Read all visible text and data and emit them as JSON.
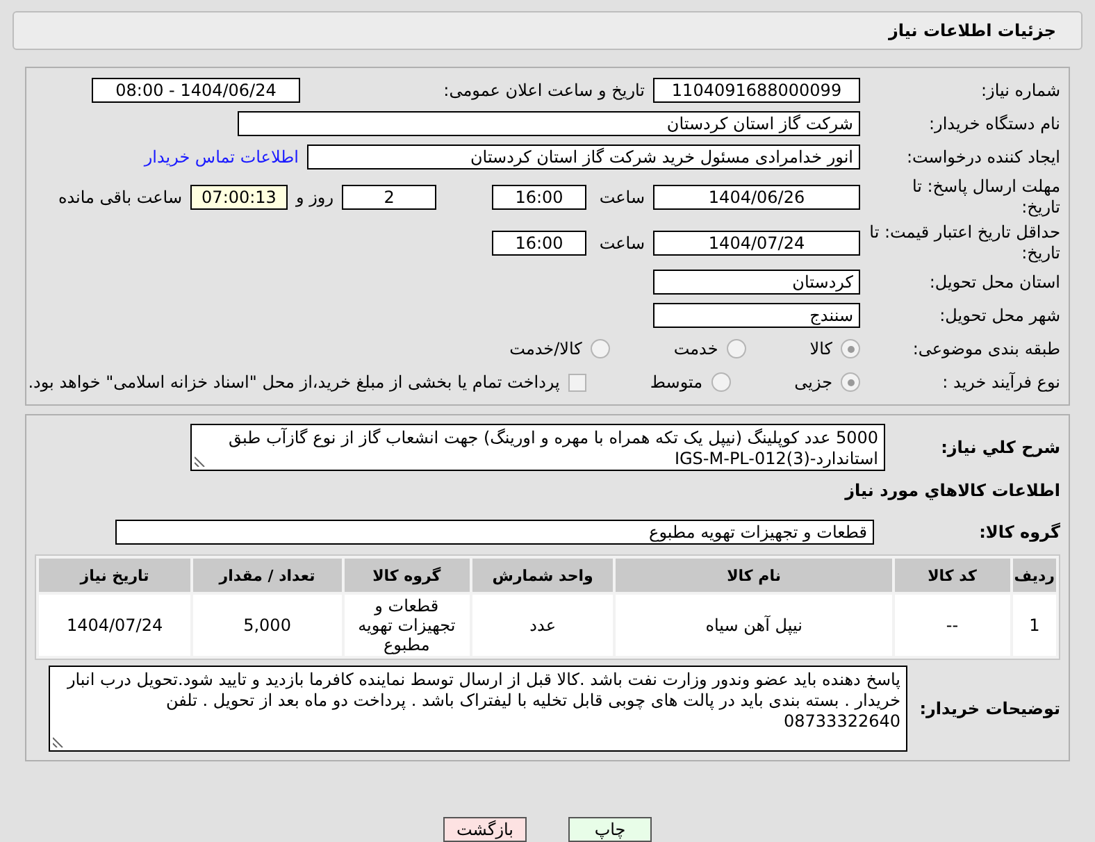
{
  "header": {
    "title": "جزئیات اطلاعات نیاز"
  },
  "need_number": {
    "label": "شماره نیاز:",
    "value": "1104091688000099"
  },
  "announce": {
    "label": "تاریخ و ساعت اعلان عمومی:",
    "value": "1404/06/24 - 08:00"
  },
  "buyer_org": {
    "label": "نام دستگاه خریدار:",
    "value": "شرکت گاز استان کردستان"
  },
  "creator": {
    "label": "ایجاد کننده درخواست:",
    "value": "انور خدامرادی مسئول خرید  شرکت گاز استان کردستان",
    "link": "اطلاعات تماس خریدار"
  },
  "response_deadline": {
    "label": "مهلت ارسال پاسخ: تا تاریخ:",
    "date": "1404/06/26",
    "time_label": "ساعت",
    "time": "16:00",
    "days": "2",
    "days_label": "روز و",
    "remaining": "07:00:13",
    "remaining_label": "ساعت باقی مانده"
  },
  "price_validity": {
    "label": "حداقل تاریخ اعتبار قیمت: تا تاریخ:",
    "date": "1404/07/24",
    "time_label": "ساعت",
    "time": "16:00"
  },
  "province": {
    "label": "استان محل تحویل:",
    "value": "کردستان"
  },
  "city": {
    "label": "شهر محل تحویل:",
    "value": "سنندج"
  },
  "category": {
    "label": "طبقه بندی موضوعی:",
    "options": [
      {
        "label": "کالا",
        "selected": true
      },
      {
        "label": "خدمت",
        "selected": false
      },
      {
        "label": "کالا/خدمت",
        "selected": false
      }
    ]
  },
  "process": {
    "label": "نوع فرآیند خرید :",
    "options": [
      {
        "label": "جزیی",
        "selected": true
      },
      {
        "label": "متوسط",
        "selected": false
      }
    ],
    "treasury": {
      "label": "پرداخت تمام یا بخشی از مبلغ خرید،از محل \"اسناد خزانه اسلامی\" خواهد بود.",
      "checked": false
    }
  },
  "summary": {
    "label": "شرح کلي نياز:",
    "value": "5000 عدد کوپلینگ (نیپل یک تکه همراه با مهره و اورینگ) جهت انشعاب گاز از نوع گازآب طبق استاندارد-IGS-M-PL-012(3)"
  },
  "goods_heading": "اطلاعات کالاهاي مورد نياز",
  "goods_group": {
    "label": "گروه کالا:",
    "value": "قطعات و تجهیزات تهویه مطبوع"
  },
  "table": {
    "columns": [
      "ردیف",
      "کد کالا",
      "نام کالا",
      "واحد شمارش",
      "گروه کالا",
      "تعداد / مقدار",
      "تاریخ نیاز"
    ],
    "rows": [
      [
        "1",
        "--",
        "نیپل آهن سیاه",
        "عدد",
        "قطعات و تجهیزات تهویه مطبوع",
        "5,000",
        "1404/07/24"
      ]
    ]
  },
  "buyer_notes": {
    "label": "توضیحات خریدار:",
    "value": "پاسخ دهنده باید عضو وندور وزارت نفت باشد .کالا قبل از ارسال توسط نماینده کافرما بازدید و تایید شود.تحویل درب انبار خریدار . بسته بندی باید در پالت های چوبی  قابل تخلیه با لیفتراک باشد . پرداخت دو ماه بعد از تحویل . تلفن 08733322640"
  },
  "buttons": [
    {
      "label": "چاپ",
      "kind": "print"
    },
    {
      "label": "بازگشت",
      "kind": "back"
    }
  ]
}
